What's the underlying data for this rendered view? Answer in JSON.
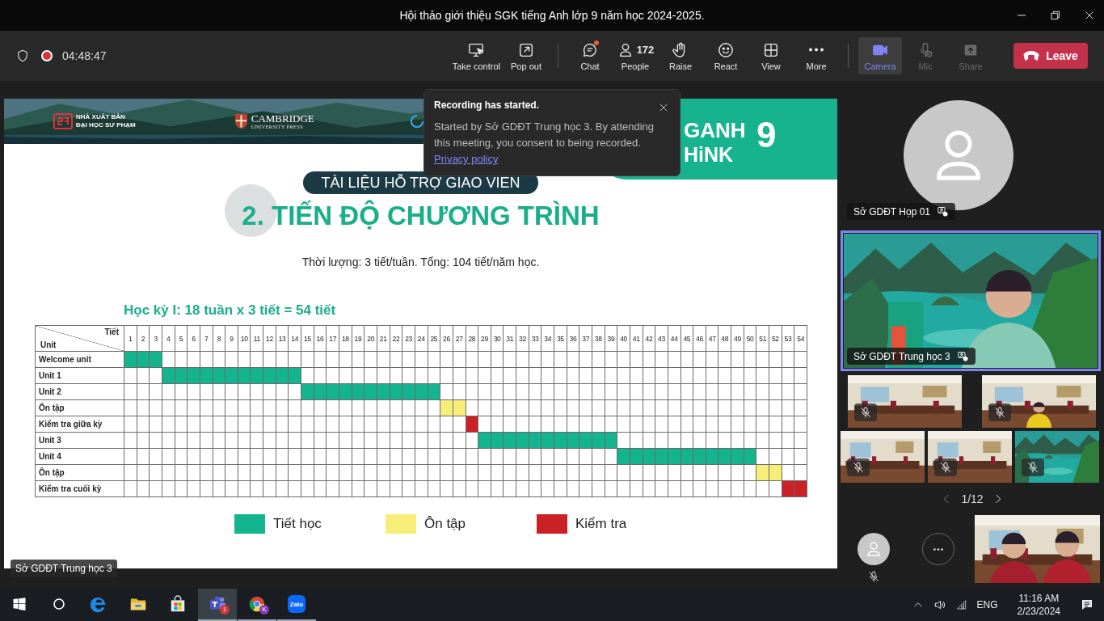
{
  "window": {
    "title": "Hội thảo giới thiệu SGK tiếng Anh lớp 9 năm học 2024-2025."
  },
  "meeting_bar": {
    "recording": true,
    "timer": "04:48:47",
    "groups": [
      {
        "actions": [
          {
            "kind": "take-control",
            "label": "Take control",
            "active": false,
            "disabled": false,
            "unread": false
          },
          {
            "kind": "pop-out",
            "label": "Pop out",
            "active": false,
            "disabled": false,
            "unread": false
          }
        ]
      },
      {
        "actions": [
          {
            "kind": "chat",
            "label": "Chat",
            "active": false,
            "disabled": false,
            "unread": true
          },
          {
            "kind": "people",
            "label": "People",
            "count": "172",
            "active": false,
            "disabled": false,
            "unread": false
          },
          {
            "kind": "raise",
            "label": "Raise",
            "active": false,
            "disabled": false,
            "unread": false
          },
          {
            "kind": "react",
            "label": "React",
            "active": false,
            "disabled": false,
            "unread": false
          },
          {
            "kind": "view",
            "label": "View",
            "active": false,
            "disabled": false,
            "unread": false
          },
          {
            "kind": "more",
            "label": "More",
            "active": false,
            "disabled": false,
            "unread": false
          }
        ]
      },
      {
        "actions": [
          {
            "kind": "camera",
            "label": "Camera",
            "active": true,
            "disabled": false,
            "unread": false
          },
          {
            "kind": "mic",
            "label": "Mic",
            "active": false,
            "disabled": true,
            "unread": false
          },
          {
            "kind": "share",
            "label": "Share",
            "active": false,
            "disabled": true,
            "unread": false
          }
        ]
      }
    ],
    "leave": {
      "label": "Leave"
    }
  },
  "notification": {
    "title": "Recording has started.",
    "body": "Started by Sở GDĐT Trung học 3. By attending this meeting, you consent to being recorded.",
    "link": "Privacy policy"
  },
  "slide": {
    "publisher": [
      "NHÀ XUẤT BẢN",
      "ĐẠI HỌC SƯ PHẠM"
    ],
    "cambridge": [
      "CAMBRIDGE",
      "UNIVERSITY PRESS"
    ],
    "brand": {
      "line_1": "GANH",
      "line_2": "HiNK",
      "grade": "9"
    },
    "tag": "TÀI LIỆU HỖ TRỢ GIAO VIEN",
    "title": "2. TIẾN ĐỘ CHƯƠNG TRÌNH",
    "subtitle": "Thời lượng: 3 tiết/tuần. Tổng: 104 tiết/năm học.",
    "schedule_title": "Học kỳ I: 18 tuần x 3 tiết = 54 tiết",
    "table": {
      "corner_top": "Tiết",
      "corner_bottom": "Unit",
      "periods": [
        "1",
        "2",
        "3",
        "4",
        "5",
        "6",
        "7",
        "8",
        "9",
        "10",
        "11",
        "12",
        "13",
        "14",
        "15",
        "16",
        "17",
        "18",
        "19",
        "20",
        "21",
        "22",
        "23",
        "24",
        "25",
        "26",
        "27",
        "28",
        "29",
        "30",
        "31",
        "32",
        "33",
        "34",
        "35",
        "36",
        "37",
        "38",
        "39",
        "40",
        "41",
        "42",
        "43",
        "44",
        "45",
        "46",
        "47",
        "48",
        "49",
        "50",
        "51",
        "52",
        "53",
        "54"
      ],
      "rows": [
        {
          "label": "Welcome unit",
          "cells": [
            {
              "kind": "lesson"
            },
            {
              "kind": "lesson"
            },
            {
              "kind": "lesson"
            },
            {
              "kind": "none"
            },
            {
              "kind": "none"
            },
            {
              "kind": "none"
            },
            {
              "kind": "none"
            },
            {
              "kind": "none"
            },
            {
              "kind": "none"
            },
            {
              "kind": "none"
            },
            {
              "kind": "none"
            },
            {
              "kind": "none"
            },
            {
              "kind": "none"
            },
            {
              "kind": "none"
            },
            {
              "kind": "none"
            },
            {
              "kind": "none"
            },
            {
              "kind": "none"
            },
            {
              "kind": "none"
            },
            {
              "kind": "none"
            },
            {
              "kind": "none"
            },
            {
              "kind": "none"
            },
            {
              "kind": "none"
            },
            {
              "kind": "none"
            },
            {
              "kind": "none"
            },
            {
              "kind": "none"
            },
            {
              "kind": "none"
            },
            {
              "kind": "none"
            },
            {
              "kind": "none"
            },
            {
              "kind": "none"
            },
            {
              "kind": "none"
            },
            {
              "kind": "none"
            },
            {
              "kind": "none"
            },
            {
              "kind": "none"
            },
            {
              "kind": "none"
            },
            {
              "kind": "none"
            },
            {
              "kind": "none"
            },
            {
              "kind": "none"
            },
            {
              "kind": "none"
            },
            {
              "kind": "none"
            },
            {
              "kind": "none"
            },
            {
              "kind": "none"
            },
            {
              "kind": "none"
            },
            {
              "kind": "none"
            },
            {
              "kind": "none"
            },
            {
              "kind": "none"
            },
            {
              "kind": "none"
            },
            {
              "kind": "none"
            },
            {
              "kind": "none"
            },
            {
              "kind": "none"
            },
            {
              "kind": "none"
            },
            {
              "kind": "none"
            },
            {
              "kind": "none"
            },
            {
              "kind": "none"
            },
            {
              "kind": "none"
            }
          ]
        },
        {
          "label": "Unit 1",
          "cells": [
            {
              "kind": "none"
            },
            {
              "kind": "none"
            },
            {
              "kind": "none"
            },
            {
              "kind": "lesson"
            },
            {
              "kind": "lesson"
            },
            {
              "kind": "lesson"
            },
            {
              "kind": "lesson"
            },
            {
              "kind": "lesson"
            },
            {
              "kind": "lesson"
            },
            {
              "kind": "lesson"
            },
            {
              "kind": "lesson"
            },
            {
              "kind": "lesson"
            },
            {
              "kind": "lesson"
            },
            {
              "kind": "lesson"
            },
            {
              "kind": "none"
            },
            {
              "kind": "none"
            },
            {
              "kind": "none"
            },
            {
              "kind": "none"
            },
            {
              "kind": "none"
            },
            {
              "kind": "none"
            },
            {
              "kind": "none"
            },
            {
              "kind": "none"
            },
            {
              "kind": "none"
            },
            {
              "kind": "none"
            },
            {
              "kind": "none"
            },
            {
              "kind": "none"
            },
            {
              "kind": "none"
            },
            {
              "kind": "none"
            },
            {
              "kind": "none"
            },
            {
              "kind": "none"
            },
            {
              "kind": "none"
            },
            {
              "kind": "none"
            },
            {
              "kind": "none"
            },
            {
              "kind": "none"
            },
            {
              "kind": "none"
            },
            {
              "kind": "none"
            },
            {
              "kind": "none"
            },
            {
              "kind": "none"
            },
            {
              "kind": "none"
            },
            {
              "kind": "none"
            },
            {
              "kind": "none"
            },
            {
              "kind": "none"
            },
            {
              "kind": "none"
            },
            {
              "kind": "none"
            },
            {
              "kind": "none"
            },
            {
              "kind": "none"
            },
            {
              "kind": "none"
            },
            {
              "kind": "none"
            },
            {
              "kind": "none"
            },
            {
              "kind": "none"
            },
            {
              "kind": "none"
            },
            {
              "kind": "none"
            },
            {
              "kind": "none"
            },
            {
              "kind": "none"
            }
          ]
        },
        {
          "label": "Unit 2",
          "cells": [
            {
              "kind": "none"
            },
            {
              "kind": "none"
            },
            {
              "kind": "none"
            },
            {
              "kind": "none"
            },
            {
              "kind": "none"
            },
            {
              "kind": "none"
            },
            {
              "kind": "none"
            },
            {
              "kind": "none"
            },
            {
              "kind": "none"
            },
            {
              "kind": "none"
            },
            {
              "kind": "none"
            },
            {
              "kind": "none"
            },
            {
              "kind": "none"
            },
            {
              "kind": "none"
            },
            {
              "kind": "lesson"
            },
            {
              "kind": "lesson"
            },
            {
              "kind": "lesson"
            },
            {
              "kind": "lesson"
            },
            {
              "kind": "lesson"
            },
            {
              "kind": "lesson"
            },
            {
              "kind": "lesson"
            },
            {
              "kind": "lesson"
            },
            {
              "kind": "lesson"
            },
            {
              "kind": "lesson"
            },
            {
              "kind": "lesson"
            },
            {
              "kind": "none"
            },
            {
              "kind": "none"
            },
            {
              "kind": "none"
            },
            {
              "kind": "none"
            },
            {
              "kind": "none"
            },
            {
              "kind": "none"
            },
            {
              "kind": "none"
            },
            {
              "kind": "none"
            },
            {
              "kind": "none"
            },
            {
              "kind": "none"
            },
            {
              "kind": "none"
            },
            {
              "kind": "none"
            },
            {
              "kind": "none"
            },
            {
              "kind": "none"
            },
            {
              "kind": "none"
            },
            {
              "kind": "none"
            },
            {
              "kind": "none"
            },
            {
              "kind": "none"
            },
            {
              "kind": "none"
            },
            {
              "kind": "none"
            },
            {
              "kind": "none"
            },
            {
              "kind": "none"
            },
            {
              "kind": "none"
            },
            {
              "kind": "none"
            },
            {
              "kind": "none"
            },
            {
              "kind": "none"
            },
            {
              "kind": "none"
            },
            {
              "kind": "none"
            },
            {
              "kind": "none"
            }
          ]
        },
        {
          "label": "Ôn tập",
          "cells": [
            {
              "kind": "none"
            },
            {
              "kind": "none"
            },
            {
              "kind": "none"
            },
            {
              "kind": "none"
            },
            {
              "kind": "none"
            },
            {
              "kind": "none"
            },
            {
              "kind": "none"
            },
            {
              "kind": "none"
            },
            {
              "kind": "none"
            },
            {
              "kind": "none"
            },
            {
              "kind": "none"
            },
            {
              "kind": "none"
            },
            {
              "kind": "none"
            },
            {
              "kind": "none"
            },
            {
              "kind": "none"
            },
            {
              "kind": "none"
            },
            {
              "kind": "none"
            },
            {
              "kind": "none"
            },
            {
              "kind": "none"
            },
            {
              "kind": "none"
            },
            {
              "kind": "none"
            },
            {
              "kind": "none"
            },
            {
              "kind": "none"
            },
            {
              "kind": "none"
            },
            {
              "kind": "none"
            },
            {
              "kind": "review"
            },
            {
              "kind": "review"
            },
            {
              "kind": "none"
            },
            {
              "kind": "none"
            },
            {
              "kind": "none"
            },
            {
              "kind": "none"
            },
            {
              "kind": "none"
            },
            {
              "kind": "none"
            },
            {
              "kind": "none"
            },
            {
              "kind": "none"
            },
            {
              "kind": "none"
            },
            {
              "kind": "none"
            },
            {
              "kind": "none"
            },
            {
              "kind": "none"
            },
            {
              "kind": "none"
            },
            {
              "kind": "none"
            },
            {
              "kind": "none"
            },
            {
              "kind": "none"
            },
            {
              "kind": "none"
            },
            {
              "kind": "none"
            },
            {
              "kind": "none"
            },
            {
              "kind": "none"
            },
            {
              "kind": "none"
            },
            {
              "kind": "none"
            },
            {
              "kind": "none"
            },
            {
              "kind": "none"
            },
            {
              "kind": "none"
            },
            {
              "kind": "none"
            },
            {
              "kind": "none"
            }
          ]
        },
        {
          "label": "Kiểm tra giữa kỳ",
          "cells": [
            {
              "kind": "none"
            },
            {
              "kind": "none"
            },
            {
              "kind": "none"
            },
            {
              "kind": "none"
            },
            {
              "kind": "none"
            },
            {
              "kind": "none"
            },
            {
              "kind": "none"
            },
            {
              "kind": "none"
            },
            {
              "kind": "none"
            },
            {
              "kind": "none"
            },
            {
              "kind": "none"
            },
            {
              "kind": "none"
            },
            {
              "kind": "none"
            },
            {
              "kind": "none"
            },
            {
              "kind": "none"
            },
            {
              "kind": "none"
            },
            {
              "kind": "none"
            },
            {
              "kind": "none"
            },
            {
              "kind": "none"
            },
            {
              "kind": "none"
            },
            {
              "kind": "none"
            },
            {
              "kind": "none"
            },
            {
              "kind": "none"
            },
            {
              "kind": "none"
            },
            {
              "kind": "none"
            },
            {
              "kind": "none"
            },
            {
              "kind": "none"
            },
            {
              "kind": "test"
            },
            {
              "kind": "none"
            },
            {
              "kind": "none"
            },
            {
              "kind": "none"
            },
            {
              "kind": "none"
            },
            {
              "kind": "none"
            },
            {
              "kind": "none"
            },
            {
              "kind": "none"
            },
            {
              "kind": "none"
            },
            {
              "kind": "none"
            },
            {
              "kind": "none"
            },
            {
              "kind": "none"
            },
            {
              "kind": "none"
            },
            {
              "kind": "none"
            },
            {
              "kind": "none"
            },
            {
              "kind": "none"
            },
            {
              "kind": "none"
            },
            {
              "kind": "none"
            },
            {
              "kind": "none"
            },
            {
              "kind": "none"
            },
            {
              "kind": "none"
            },
            {
              "kind": "none"
            },
            {
              "kind": "none"
            },
            {
              "kind": "none"
            },
            {
              "kind": "none"
            },
            {
              "kind": "none"
            },
            {
              "kind": "none"
            }
          ]
        },
        {
          "label": "Unit 3",
          "cells": [
            {
              "kind": "none"
            },
            {
              "kind": "none"
            },
            {
              "kind": "none"
            },
            {
              "kind": "none"
            },
            {
              "kind": "none"
            },
            {
              "kind": "none"
            },
            {
              "kind": "none"
            },
            {
              "kind": "none"
            },
            {
              "kind": "none"
            },
            {
              "kind": "none"
            },
            {
              "kind": "none"
            },
            {
              "kind": "none"
            },
            {
              "kind": "none"
            },
            {
              "kind": "none"
            },
            {
              "kind": "none"
            },
            {
              "kind": "none"
            },
            {
              "kind": "none"
            },
            {
              "kind": "none"
            },
            {
              "kind": "none"
            },
            {
              "kind": "none"
            },
            {
              "kind": "none"
            },
            {
              "kind": "none"
            },
            {
              "kind": "none"
            },
            {
              "kind": "none"
            },
            {
              "kind": "none"
            },
            {
              "kind": "none"
            },
            {
              "kind": "none"
            },
            {
              "kind": "none"
            },
            {
              "kind": "lesson"
            },
            {
              "kind": "lesson"
            },
            {
              "kind": "lesson"
            },
            {
              "kind": "lesson"
            },
            {
              "kind": "lesson"
            },
            {
              "kind": "lesson"
            },
            {
              "kind": "lesson"
            },
            {
              "kind": "lesson"
            },
            {
              "kind": "lesson"
            },
            {
              "kind": "lesson"
            },
            {
              "kind": "lesson"
            },
            {
              "kind": "none"
            },
            {
              "kind": "none"
            },
            {
              "kind": "none"
            },
            {
              "kind": "none"
            },
            {
              "kind": "none"
            },
            {
              "kind": "none"
            },
            {
              "kind": "none"
            },
            {
              "kind": "none"
            },
            {
              "kind": "none"
            },
            {
              "kind": "none"
            },
            {
              "kind": "none"
            },
            {
              "kind": "none"
            },
            {
              "kind": "none"
            },
            {
              "kind": "none"
            },
            {
              "kind": "none"
            }
          ]
        },
        {
          "label": "Unit 4",
          "cells": [
            {
              "kind": "none"
            },
            {
              "kind": "none"
            },
            {
              "kind": "none"
            },
            {
              "kind": "none"
            },
            {
              "kind": "none"
            },
            {
              "kind": "none"
            },
            {
              "kind": "none"
            },
            {
              "kind": "none"
            },
            {
              "kind": "none"
            },
            {
              "kind": "none"
            },
            {
              "kind": "none"
            },
            {
              "kind": "none"
            },
            {
              "kind": "none"
            },
            {
              "kind": "none"
            },
            {
              "kind": "none"
            },
            {
              "kind": "none"
            },
            {
              "kind": "none"
            },
            {
              "kind": "none"
            },
            {
              "kind": "none"
            },
            {
              "kind": "none"
            },
            {
              "kind": "none"
            },
            {
              "kind": "none"
            },
            {
              "kind": "none"
            },
            {
              "kind": "none"
            },
            {
              "kind": "none"
            },
            {
              "kind": "none"
            },
            {
              "kind": "none"
            },
            {
              "kind": "none"
            },
            {
              "kind": "none"
            },
            {
              "kind": "none"
            },
            {
              "kind": "none"
            },
            {
              "kind": "none"
            },
            {
              "kind": "none"
            },
            {
              "kind": "none"
            },
            {
              "kind": "none"
            },
            {
              "kind": "none"
            },
            {
              "kind": "none"
            },
            {
              "kind": "none"
            },
            {
              "kind": "none"
            },
            {
              "kind": "lesson"
            },
            {
              "kind": "lesson"
            },
            {
              "kind": "lesson"
            },
            {
              "kind": "lesson"
            },
            {
              "kind": "lesson"
            },
            {
              "kind": "lesson"
            },
            {
              "kind": "lesson"
            },
            {
              "kind": "lesson"
            },
            {
              "kind": "lesson"
            },
            {
              "kind": "lesson"
            },
            {
              "kind": "lesson"
            },
            {
              "kind": "none"
            },
            {
              "kind": "none"
            },
            {
              "kind": "none"
            },
            {
              "kind": "none"
            }
          ]
        },
        {
          "label": "Ôn tập",
          "cells": [
            {
              "kind": "none"
            },
            {
              "kind": "none"
            },
            {
              "kind": "none"
            },
            {
              "kind": "none"
            },
            {
              "kind": "none"
            },
            {
              "kind": "none"
            },
            {
              "kind": "none"
            },
            {
              "kind": "none"
            },
            {
              "kind": "none"
            },
            {
              "kind": "none"
            },
            {
              "kind": "none"
            },
            {
              "kind": "none"
            },
            {
              "kind": "none"
            },
            {
              "kind": "none"
            },
            {
              "kind": "none"
            },
            {
              "kind": "none"
            },
            {
              "kind": "none"
            },
            {
              "kind": "none"
            },
            {
              "kind": "none"
            },
            {
              "kind": "none"
            },
            {
              "kind": "none"
            },
            {
              "kind": "none"
            },
            {
              "kind": "none"
            },
            {
              "kind": "none"
            },
            {
              "kind": "none"
            },
            {
              "kind": "none"
            },
            {
              "kind": "none"
            },
            {
              "kind": "none"
            },
            {
              "kind": "none"
            },
            {
              "kind": "none"
            },
            {
              "kind": "none"
            },
            {
              "kind": "none"
            },
            {
              "kind": "none"
            },
            {
              "kind": "none"
            },
            {
              "kind": "none"
            },
            {
              "kind": "none"
            },
            {
              "kind": "none"
            },
            {
              "kind": "none"
            },
            {
              "kind": "none"
            },
            {
              "kind": "none"
            },
            {
              "kind": "none"
            },
            {
              "kind": "none"
            },
            {
              "kind": "none"
            },
            {
              "kind": "none"
            },
            {
              "kind": "none"
            },
            {
              "kind": "none"
            },
            {
              "kind": "none"
            },
            {
              "kind": "none"
            },
            {
              "kind": "none"
            },
            {
              "kind": "none"
            },
            {
              "kind": "review"
            },
            {
              "kind": "review"
            },
            {
              "kind": "none"
            },
            {
              "kind": "none"
            }
          ]
        },
        {
          "label": "Kiểm tra cuối kỳ",
          "cells": [
            {
              "kind": "none"
            },
            {
              "kind": "none"
            },
            {
              "kind": "none"
            },
            {
              "kind": "none"
            },
            {
              "kind": "none"
            },
            {
              "kind": "none"
            },
            {
              "kind": "none"
            },
            {
              "kind": "none"
            },
            {
              "kind": "none"
            },
            {
              "kind": "none"
            },
            {
              "kind": "none"
            },
            {
              "kind": "none"
            },
            {
              "kind": "none"
            },
            {
              "kind": "none"
            },
            {
              "kind": "none"
            },
            {
              "kind": "none"
            },
            {
              "kind": "none"
            },
            {
              "kind": "none"
            },
            {
              "kind": "none"
            },
            {
              "kind": "none"
            },
            {
              "kind": "none"
            },
            {
              "kind": "none"
            },
            {
              "kind": "none"
            },
            {
              "kind": "none"
            },
            {
              "kind": "none"
            },
            {
              "kind": "none"
            },
            {
              "kind": "none"
            },
            {
              "kind": "none"
            },
            {
              "kind": "none"
            },
            {
              "kind": "none"
            },
            {
              "kind": "none"
            },
            {
              "kind": "none"
            },
            {
              "kind": "none"
            },
            {
              "kind": "none"
            },
            {
              "kind": "none"
            },
            {
              "kind": "none"
            },
            {
              "kind": "none"
            },
            {
              "kind": "none"
            },
            {
              "kind": "none"
            },
            {
              "kind": "none"
            },
            {
              "kind": "none"
            },
            {
              "kind": "none"
            },
            {
              "kind": "none"
            },
            {
              "kind": "none"
            },
            {
              "kind": "none"
            },
            {
              "kind": "none"
            },
            {
              "kind": "none"
            },
            {
              "kind": "none"
            },
            {
              "kind": "none"
            },
            {
              "kind": "none"
            },
            {
              "kind": "none"
            },
            {
              "kind": "none"
            },
            {
              "kind": "test"
            },
            {
              "kind": "test"
            }
          ]
        }
      ]
    },
    "legend": [
      {
        "kind": "lesson",
        "label": "Tiết học",
        "color": "#13b48e"
      },
      {
        "kind": "review",
        "label": "Ôn tập",
        "color": "#f7ee7a"
      },
      {
        "kind": "test",
        "label": "Kiểm tra",
        "color": "#cc2027"
      }
    ]
  },
  "presenter_label": "Sở GDĐT Trung học 3",
  "participants": {
    "tiles": [
      {
        "kind": "avatar",
        "name": "Sở GDĐT Họp 01"
      },
      {
        "kind": "video",
        "name": "Sở GDĐT Trung học 3",
        "speaking": true,
        "muted": false
      },
      {
        "kind": "video",
        "speaking": false,
        "muted": true
      },
      {
        "kind": "video",
        "speaking": false,
        "muted": true
      },
      {
        "kind": "video",
        "speaking": false,
        "muted": true
      },
      {
        "kind": "video",
        "speaking": false,
        "muted": true
      },
      {
        "kind": "video",
        "speaking": false,
        "muted": true
      }
    ],
    "page": "1/12",
    "self": {
      "muted": true
    },
    "bottom_tiles": [
      {
        "kind": "video"
      }
    ]
  },
  "taskbar": {
    "apps": [
      {
        "kind": "start",
        "running": false,
        "active": false
      },
      {
        "kind": "search",
        "running": false,
        "active": false
      },
      {
        "kind": "edge",
        "running": false,
        "active": false
      },
      {
        "kind": "explorer",
        "running": false,
        "active": false
      },
      {
        "kind": "store",
        "running": false,
        "active": false
      },
      {
        "kind": "teams",
        "running": true,
        "active": true,
        "badge": "1"
      },
      {
        "kind": "chrome",
        "running": true,
        "active": false,
        "badge": "K"
      },
      {
        "kind": "zalo",
        "label": "Zalo",
        "running": true,
        "active": false
      }
    ],
    "tray": {
      "language": "ENG",
      "time": "11:16 AM",
      "date": "2/23/2024"
    }
  }
}
